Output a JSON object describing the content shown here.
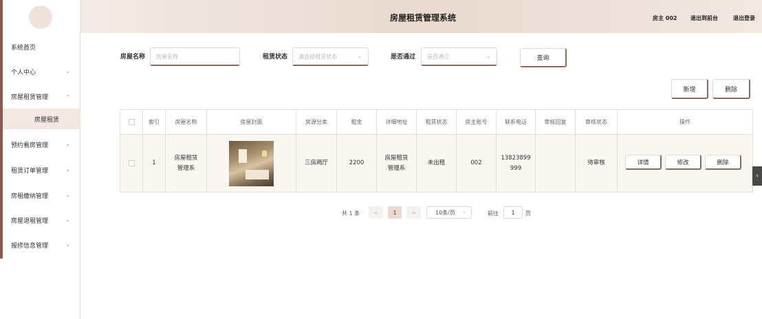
{
  "header": {
    "title": "房屋租赁管理系统",
    "user": "房主 002",
    "front_link": "退出到前台",
    "logout_link": "退出登录"
  },
  "sidebar": {
    "items": [
      {
        "label": "系统首页"
      },
      {
        "label": "个人中心"
      },
      {
        "label": "房屋租赁管理"
      },
      {
        "label": "预约看房管理"
      },
      {
        "label": "租赁订单管理"
      },
      {
        "label": "房租缴纳管理"
      },
      {
        "label": "房屋退租管理"
      },
      {
        "label": "报修信息管理"
      }
    ],
    "subitem": "房屋租赁"
  },
  "search": {
    "name_label": "房屋名称",
    "name_placeholder": "房屋名称",
    "status_label": "租赁状态",
    "status_placeholder": "请选择租赁状态",
    "passed_label": "是否通过",
    "passed_placeholder": "是否通过",
    "query_button": "查询"
  },
  "actions": {
    "add": "新增",
    "delete": "删除"
  },
  "table": {
    "columns": [
      "索引",
      "房屋名称",
      "房屋封面",
      "房源分类",
      "租金",
      "详细地址",
      "租赁状态",
      "房主账号",
      "联系电话",
      "审核回复",
      "审核状态",
      "操作"
    ],
    "rows": [
      {
        "index": "1",
        "name_line1": "房屋租赁",
        "name_line2": "管理系",
        "category": "三房两厅",
        "rent": "2200",
        "address_line1": "房屋租赁",
        "address_line2": "管理系",
        "status": "未出租",
        "owner": "002",
        "phone_line1": "13823899",
        "phone_line2": "999",
        "reply": "",
        "audit": "待审核",
        "btn_detail": "详情",
        "btn_edit": "修改",
        "btn_delete": "删除"
      }
    ]
  },
  "pagination": {
    "total": "共 1 条",
    "prev": "<",
    "current": "1",
    "next": ">",
    "page_size": "10条/页",
    "goto_label": "前往",
    "goto_value": "1",
    "page_suffix": "页"
  },
  "colors": {
    "accent": "#8a5a4e",
    "header_bg": "#e9d9cf",
    "active_bg": "#f3e7e1"
  }
}
